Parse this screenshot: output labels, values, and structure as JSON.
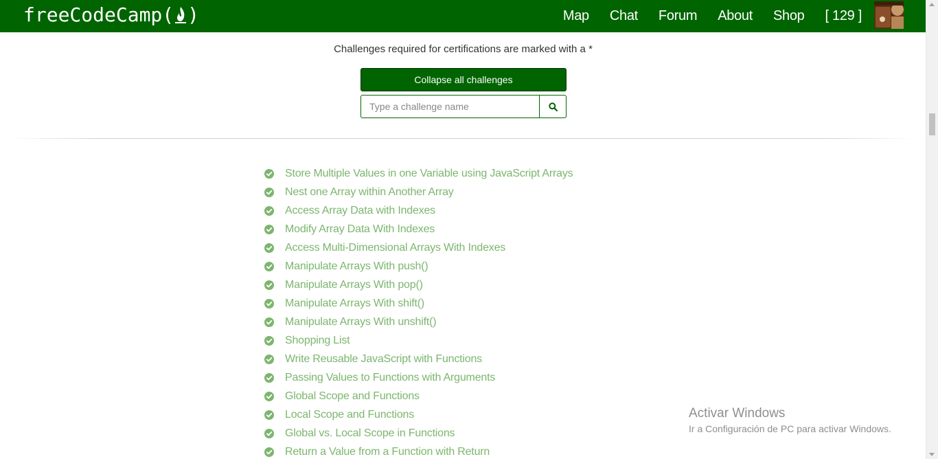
{
  "nav": {
    "logo": "freeCodeCamp(",
    "logo_end": ")",
    "links": [
      "Map",
      "Chat",
      "Forum",
      "About",
      "Shop"
    ],
    "points": "[ 129 ]"
  },
  "main": {
    "notice": "Challenges required for certifications are marked with a *",
    "collapse_label": "Collapse all challenges",
    "search_placeholder": "Type a challenge name",
    "challenges": [
      "Store Multiple Values in one Variable using JavaScript Arrays",
      "Nest one Array within Another Array",
      "Access Array Data with Indexes",
      "Modify Array Data With Indexes",
      "Access Multi-Dimensional Arrays With Indexes",
      "Manipulate Arrays With push()",
      "Manipulate Arrays With pop()",
      "Manipulate Arrays With shift()",
      "Manipulate Arrays With unshift()",
      "Shopping List",
      "Write Reusable JavaScript with Functions",
      "Passing Values to Functions with Arguments",
      "Global Scope and Functions",
      "Local Scope and Functions",
      "Global vs. Local Scope in Functions",
      "Return a Value from a Function with Return"
    ]
  },
  "watermark": {
    "title": "Activar Windows",
    "subtitle": "Ir a Configuración de PC para activar Windows."
  },
  "colors": {
    "brand": "#006400",
    "completed": "#7cb66e"
  },
  "icons": {
    "search": "search-icon",
    "completed": "check-circle-icon",
    "logo": "flame-icon"
  }
}
